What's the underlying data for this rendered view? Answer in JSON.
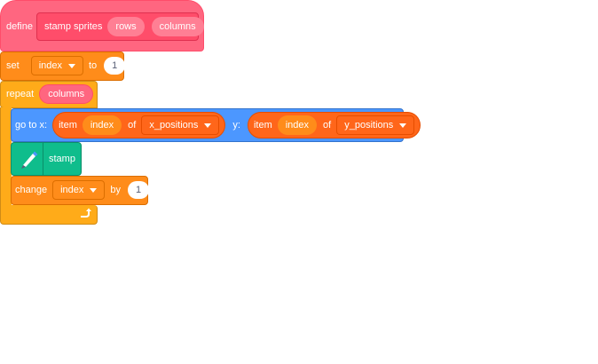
{
  "define_block": {
    "keyword": "define",
    "name": "stamp sprites",
    "params": [
      "rows",
      "columns"
    ]
  },
  "set_block": {
    "keyword": "set",
    "variable": "index",
    "to_label": "to",
    "value": "1"
  },
  "repeat_block": {
    "keyword": "repeat",
    "arg": "columns"
  },
  "goto_block": {
    "label": "go to x:",
    "x_item": {
      "item_label": "item",
      "index": "index",
      "of_label": "of",
      "list": "x_positions"
    },
    "y_label": "y:",
    "y_item": {
      "item_label": "item",
      "index": "index",
      "of_label": "of",
      "list": "y_positions"
    }
  },
  "stamp_block": {
    "label": "stamp",
    "icon": "pen-icon"
  },
  "change_block": {
    "keyword": "change",
    "variable": "index",
    "by_label": "by",
    "value": "1"
  },
  "loop_arrow": {
    "icon": "loop-arrow-icon"
  },
  "colors": {
    "define": "#ff6680",
    "define_dark": "#ff4d6a",
    "variables": "#ff8c1a",
    "variables_dark": "#db6e00",
    "control": "#ffab19",
    "control_dark": "#cf8b17",
    "motion": "#4c97ff",
    "motion_dark": "#3373cc",
    "list": "#ff661a",
    "list_dark": "#e64d00",
    "pen": "#0fbd8c",
    "pen_dark": "#0b8e69"
  }
}
